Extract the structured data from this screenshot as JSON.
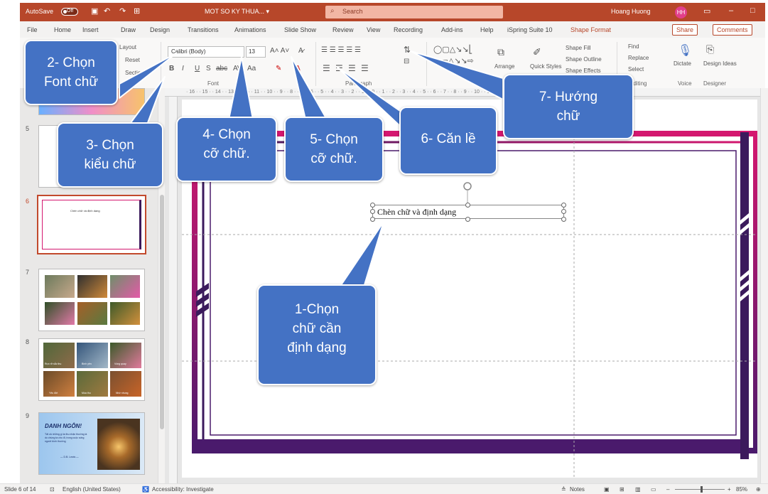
{
  "titlebar": {
    "autosave": "AutoSave",
    "autosave_state": "Off",
    "doc_title": "MOT SO KY THUA... ▾",
    "search_placeholder": "Search",
    "user_name": "Hoang Huong",
    "user_initials": "HH"
  },
  "tabs": [
    "File",
    "Home",
    "Insert",
    "Draw",
    "Design",
    "Transitions",
    "Animations",
    "Slide Show",
    "Review",
    "View",
    "Recording",
    "Add-ins",
    "Help",
    "iSpring Suite 10",
    "Shape Format"
  ],
  "header_buttons": {
    "share": "Share",
    "comments": "Comments"
  },
  "ribbon": {
    "layout": "Layout",
    "reset": "Reset",
    "section": "Section",
    "font_name": "Calibri (Body)",
    "font_size": "13",
    "font_group": "Font",
    "paragraph_group": "Paragraph",
    "arrange": "Arrange",
    "quick_styles": "Quick Styles",
    "shape_fill": "Shape Fill",
    "shape_outline": "Shape Outline",
    "shape_effects": "Shape Effects",
    "find": "Find",
    "replace": "Replace",
    "select": "Select",
    "editing_group": "Editing",
    "dictate": "Dictate",
    "voice_group": "Voice",
    "design_ideas": "Design Ideas",
    "designer_group": "Designer",
    "ruler_text": "· 16 · · 15 · · 14 · · 13 · · 12 · · 11 · · 10 · · 9 · · 8 · · 7 · · 6 · · 5 · · 4 · · 3 · · 2 · · 1 · · 0 · · 1 · · 2 · · 3 · · 4 · · 5 · · 6 · · 7 · · 8 · · 9 · · 10 · · 11 · · 12 · · 13 · · 14 · · 15 · · 16 ·"
  },
  "thumbnails": [
    {
      "num": "5",
      "caption": ""
    },
    {
      "num": "6",
      "caption": "Chèn chữ và định dạng"
    },
    {
      "num": "7",
      "caption": ""
    },
    {
      "num": "8",
      "captions": [
        "Rực rỡ sắc thu",
        "Bình yên",
        "Vòng quay",
        "Yêu đời",
        "Mùa thu",
        "Nhớ nhung"
      ]
    },
    {
      "num": "9",
      "title": "DANH NGÔN!",
      "body": "Tất cả những gì ta thu nhận thường là do chúng ta cho đi, trong cuộc sống người bình thường",
      "author": "— D.B. Lewis —"
    }
  ],
  "slide": {
    "textbox_text": "Chèn chữ và định dạng"
  },
  "callouts": {
    "c1": "1-Chọn chữ cần định dạng",
    "c1_lines": [
      "1-Chọn",
      "chữ cần",
      "định dạng"
    ],
    "c2_lines": [
      "2- Chọn",
      "Font chữ"
    ],
    "c3_lines": [
      "3- Chọn",
      "kiểu chữ"
    ],
    "c4_lines": [
      "4- Chọn",
      "cỡ chữ."
    ],
    "c5_lines": [
      "5- Chọn",
      "cỡ chữ."
    ],
    "c6_lines": [
      "6- Căn lề"
    ],
    "c7_lines": [
      "7- Hướng",
      "chữ"
    ]
  },
  "statusbar": {
    "slide_info": "Slide 6 of 14",
    "language": "English (United States)",
    "accessibility": "Accessibility: Investigate",
    "notes": "Notes",
    "zoom": "85%"
  },
  "colors": {
    "accent": "#b7472a",
    "callout": "#4472c4",
    "frame_dark": "#3b1a5c",
    "frame_pink": "#d4176f"
  }
}
